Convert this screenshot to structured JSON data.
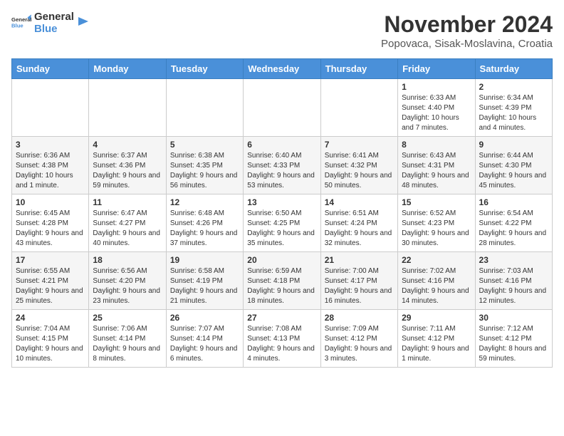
{
  "logo": {
    "general": "General",
    "blue": "Blue"
  },
  "title": "November 2024",
  "location": "Popovaca, Sisak-Moslavina, Croatia",
  "headers": [
    "Sunday",
    "Monday",
    "Tuesday",
    "Wednesday",
    "Thursday",
    "Friday",
    "Saturday"
  ],
  "weeks": [
    [
      {
        "day": "",
        "info": ""
      },
      {
        "day": "",
        "info": ""
      },
      {
        "day": "",
        "info": ""
      },
      {
        "day": "",
        "info": ""
      },
      {
        "day": "",
        "info": ""
      },
      {
        "day": "1",
        "info": "Sunrise: 6:33 AM\nSunset: 4:40 PM\nDaylight: 10 hours and 7 minutes."
      },
      {
        "day": "2",
        "info": "Sunrise: 6:34 AM\nSunset: 4:39 PM\nDaylight: 10 hours and 4 minutes."
      }
    ],
    [
      {
        "day": "3",
        "info": "Sunrise: 6:36 AM\nSunset: 4:38 PM\nDaylight: 10 hours and 1 minute."
      },
      {
        "day": "4",
        "info": "Sunrise: 6:37 AM\nSunset: 4:36 PM\nDaylight: 9 hours and 59 minutes."
      },
      {
        "day": "5",
        "info": "Sunrise: 6:38 AM\nSunset: 4:35 PM\nDaylight: 9 hours and 56 minutes."
      },
      {
        "day": "6",
        "info": "Sunrise: 6:40 AM\nSunset: 4:33 PM\nDaylight: 9 hours and 53 minutes."
      },
      {
        "day": "7",
        "info": "Sunrise: 6:41 AM\nSunset: 4:32 PM\nDaylight: 9 hours and 50 minutes."
      },
      {
        "day": "8",
        "info": "Sunrise: 6:43 AM\nSunset: 4:31 PM\nDaylight: 9 hours and 48 minutes."
      },
      {
        "day": "9",
        "info": "Sunrise: 6:44 AM\nSunset: 4:30 PM\nDaylight: 9 hours and 45 minutes."
      }
    ],
    [
      {
        "day": "10",
        "info": "Sunrise: 6:45 AM\nSunset: 4:28 PM\nDaylight: 9 hours and 43 minutes."
      },
      {
        "day": "11",
        "info": "Sunrise: 6:47 AM\nSunset: 4:27 PM\nDaylight: 9 hours and 40 minutes."
      },
      {
        "day": "12",
        "info": "Sunrise: 6:48 AM\nSunset: 4:26 PM\nDaylight: 9 hours and 37 minutes."
      },
      {
        "day": "13",
        "info": "Sunrise: 6:50 AM\nSunset: 4:25 PM\nDaylight: 9 hours and 35 minutes."
      },
      {
        "day": "14",
        "info": "Sunrise: 6:51 AM\nSunset: 4:24 PM\nDaylight: 9 hours and 32 minutes."
      },
      {
        "day": "15",
        "info": "Sunrise: 6:52 AM\nSunset: 4:23 PM\nDaylight: 9 hours and 30 minutes."
      },
      {
        "day": "16",
        "info": "Sunrise: 6:54 AM\nSunset: 4:22 PM\nDaylight: 9 hours and 28 minutes."
      }
    ],
    [
      {
        "day": "17",
        "info": "Sunrise: 6:55 AM\nSunset: 4:21 PM\nDaylight: 9 hours and 25 minutes."
      },
      {
        "day": "18",
        "info": "Sunrise: 6:56 AM\nSunset: 4:20 PM\nDaylight: 9 hours and 23 minutes."
      },
      {
        "day": "19",
        "info": "Sunrise: 6:58 AM\nSunset: 4:19 PM\nDaylight: 9 hours and 21 minutes."
      },
      {
        "day": "20",
        "info": "Sunrise: 6:59 AM\nSunset: 4:18 PM\nDaylight: 9 hours and 18 minutes."
      },
      {
        "day": "21",
        "info": "Sunrise: 7:00 AM\nSunset: 4:17 PM\nDaylight: 9 hours and 16 minutes."
      },
      {
        "day": "22",
        "info": "Sunrise: 7:02 AM\nSunset: 4:16 PM\nDaylight: 9 hours and 14 minutes."
      },
      {
        "day": "23",
        "info": "Sunrise: 7:03 AM\nSunset: 4:16 PM\nDaylight: 9 hours and 12 minutes."
      }
    ],
    [
      {
        "day": "24",
        "info": "Sunrise: 7:04 AM\nSunset: 4:15 PM\nDaylight: 9 hours and 10 minutes."
      },
      {
        "day": "25",
        "info": "Sunrise: 7:06 AM\nSunset: 4:14 PM\nDaylight: 9 hours and 8 minutes."
      },
      {
        "day": "26",
        "info": "Sunrise: 7:07 AM\nSunset: 4:14 PM\nDaylight: 9 hours and 6 minutes."
      },
      {
        "day": "27",
        "info": "Sunrise: 7:08 AM\nSunset: 4:13 PM\nDaylight: 9 hours and 4 minutes."
      },
      {
        "day": "28",
        "info": "Sunrise: 7:09 AM\nSunset: 4:12 PM\nDaylight: 9 hours and 3 minutes."
      },
      {
        "day": "29",
        "info": "Sunrise: 7:11 AM\nSunset: 4:12 PM\nDaylight: 9 hours and 1 minute."
      },
      {
        "day": "30",
        "info": "Sunrise: 7:12 AM\nSunset: 4:12 PM\nDaylight: 8 hours and 59 minutes."
      }
    ]
  ]
}
